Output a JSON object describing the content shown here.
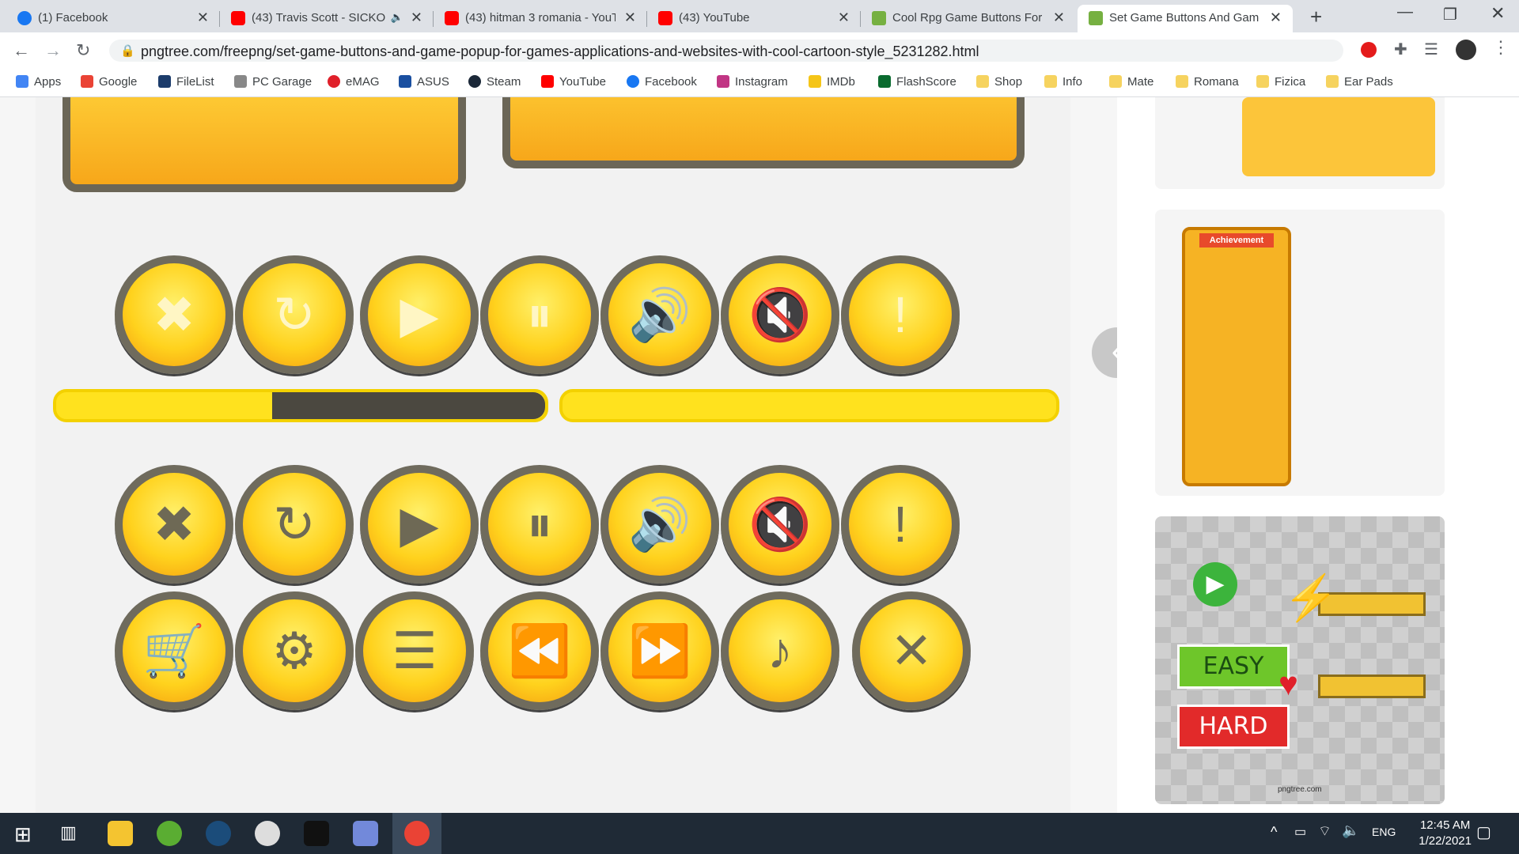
{
  "tabs": [
    {
      "title": "(1) Facebook"
    },
    {
      "title": "(43) Travis Scott - SICKO"
    },
    {
      "title": "(43) hitman 3 romania - YouT"
    },
    {
      "title": "(43) YouTube"
    },
    {
      "title": "Cool Rpg Game Buttons For"
    },
    {
      "title": "Set Game Buttons And Game"
    }
  ],
  "address": {
    "url": "pngtree.com/freepng/set-game-buttons-and-game-popup-for-games-applications-and-websites-with-cool-cartoon-style_5231282.html"
  },
  "bookmarks": [
    "Apps",
    "Google",
    "FileList",
    "PC Garage",
    "eMAG",
    "ASUS",
    "Steam",
    "YouTube",
    "Facebook",
    "Instagram",
    "IMDb",
    "FlashScore",
    "Shop",
    "Info",
    "Mate",
    "Romana",
    "Fizica",
    "Ear Pads"
  ],
  "thumbs": {
    "achievement_title": "Achievement",
    "easy": "EASY",
    "hard": "HARD",
    "footer": "pngtree.com"
  },
  "progress": {
    "left_fill": 0.45,
    "right_fill": 1.0
  },
  "taskbar": {
    "lang": "ENG",
    "time": "12:45 AM",
    "date": "1/22/2021"
  }
}
